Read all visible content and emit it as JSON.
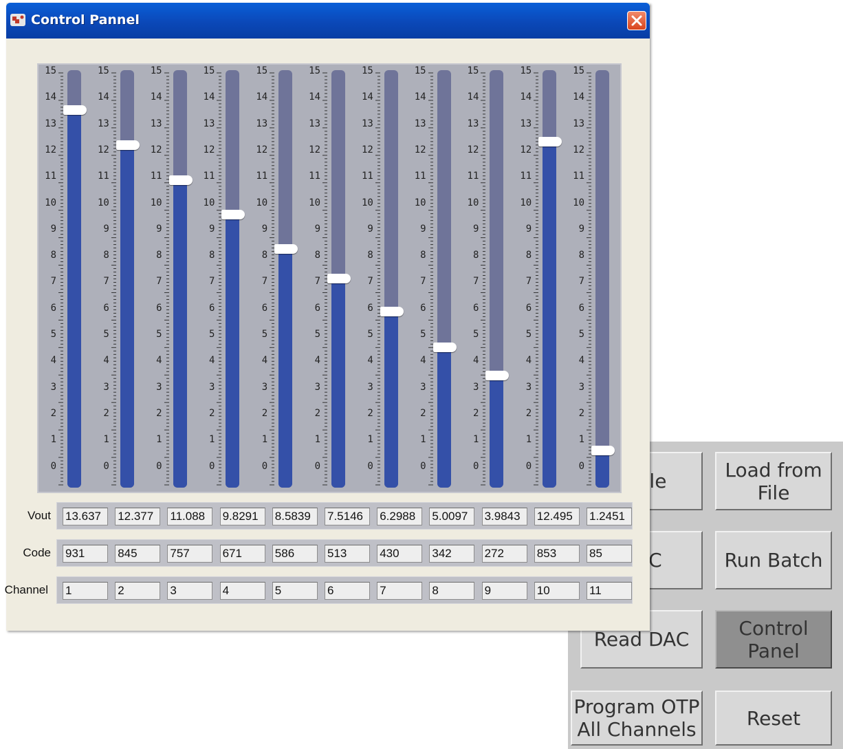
{
  "window": {
    "title": "Control Pannel"
  },
  "sliders": {
    "scale_max": 15,
    "tick_labels": [
      "15",
      "14",
      "13",
      "12",
      "11",
      "10",
      "9",
      "8",
      "7",
      "6",
      "5",
      "4",
      "3",
      "2",
      "1",
      "0"
    ],
    "channels": [
      {
        "vout": "13.637",
        "code": "931",
        "channel": "1",
        "level": 13.637
      },
      {
        "vout": "12.377",
        "code": "845",
        "channel": "2",
        "level": 12.377
      },
      {
        "vout": "11.088",
        "code": "757",
        "channel": "3",
        "level": 11.088
      },
      {
        "vout": "9.8291",
        "code": "671",
        "channel": "4",
        "level": 9.8291
      },
      {
        "vout": "8.5839",
        "code": "586",
        "channel": "5",
        "level": 8.5839
      },
      {
        "vout": "7.5146",
        "code": "513",
        "channel": "6",
        "level": 7.5146
      },
      {
        "vout": "6.2988",
        "code": "430",
        "channel": "7",
        "level": 6.2988
      },
      {
        "vout": "5.0097",
        "code": "342",
        "channel": "8",
        "level": 5.0097
      },
      {
        "vout": "3.9843",
        "code": "272",
        "channel": "9",
        "level": 3.9843
      },
      {
        "vout": "12.495",
        "code": "853",
        "channel": "10",
        "level": 12.495
      },
      {
        "vout": "1.2451",
        "code": "85",
        "channel": "11",
        "level": 1.2451
      }
    ]
  },
  "rows": {
    "vout_label": "Vout",
    "code_label": "Code",
    "channel_label": "Channel"
  },
  "background_panel": {
    "buttons": [
      {
        "label": "Save to File",
        "visible_label": "o File"
      },
      {
        "label": "Load from\nFile"
      },
      {
        "label": "Write DAC",
        "visible_label": "DAC"
      },
      {
        "label": "Run Batch"
      },
      {
        "label": "Read DAC"
      },
      {
        "label": "Control\nPanel",
        "active": true
      },
      {
        "label": "Program OTP\nAll Channels"
      },
      {
        "label": "Reset"
      }
    ]
  },
  "colors": {
    "titlebar": "#0b48b8",
    "window_bg": "#efece0",
    "slider_bg": "#aeb0ba",
    "track": "#6f7499",
    "fill": "#3450a8",
    "close": "#d9441c"
  }
}
